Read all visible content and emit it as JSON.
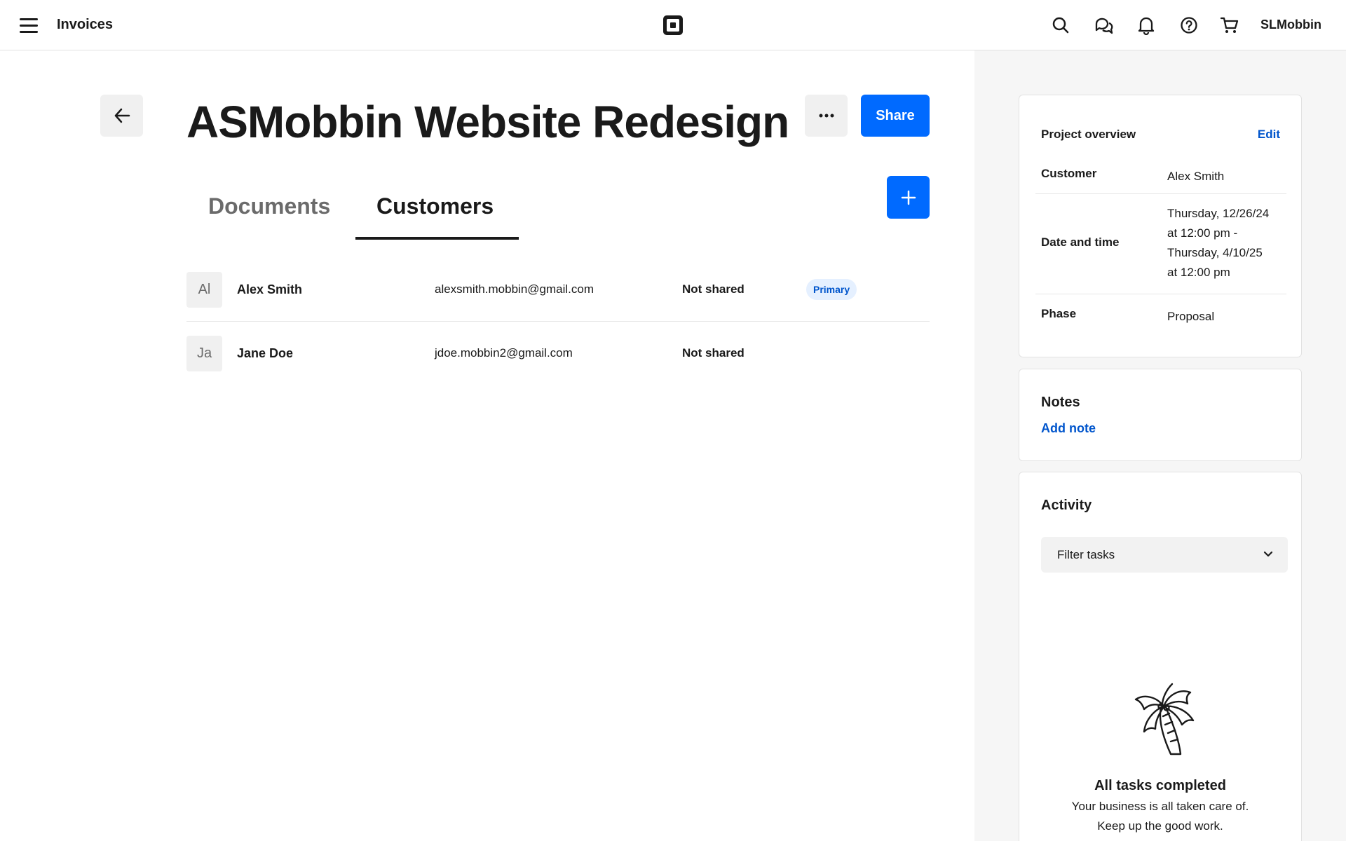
{
  "header": {
    "app_title": "Invoices",
    "username": "SLMobbin",
    "icons": [
      "menu-icon",
      "square-logo-icon",
      "search-icon",
      "chat-icon",
      "bell-icon",
      "help-icon",
      "cart-icon"
    ]
  },
  "page": {
    "title": "ASMobbin Website Redesign",
    "share_label": "Share"
  },
  "tabs": [
    {
      "label": "Documents",
      "active": false
    },
    {
      "label": "Customers",
      "active": true
    }
  ],
  "customers": [
    {
      "initials": "Al",
      "name": "Alex Smith",
      "email": "alexsmith.mobbin@gmail.com",
      "status": "Not shared",
      "badge": "Primary"
    },
    {
      "initials": "Ja",
      "name": "Jane Doe",
      "email": "jdoe.mobbin2@gmail.com",
      "status": "Not shared",
      "badge": ""
    }
  ],
  "overview": {
    "title": "Project overview",
    "edit_label": "Edit",
    "rows": [
      {
        "label": "Customer",
        "value": "Alex Smith"
      },
      {
        "label": "Date and time",
        "value_lines": [
          "Thursday, 12/26/24",
          "at 12:00 pm -",
          "Thursday, 4/10/25",
          "at 12:00 pm"
        ]
      },
      {
        "label": "Phase",
        "value": "Proposal"
      }
    ]
  },
  "notes": {
    "title": "Notes",
    "add_label": "Add note"
  },
  "activity": {
    "title": "Activity",
    "filter_label": "Filter tasks",
    "empty_title": "All tasks completed",
    "empty_lines": [
      "Your business is all taken care of.",
      "Keep up the good work."
    ]
  },
  "colors": {
    "accent": "#006aff",
    "link": "#0055cc",
    "badge_bg": "#e5f0ff",
    "panel_bg": "#f6f6f6"
  }
}
